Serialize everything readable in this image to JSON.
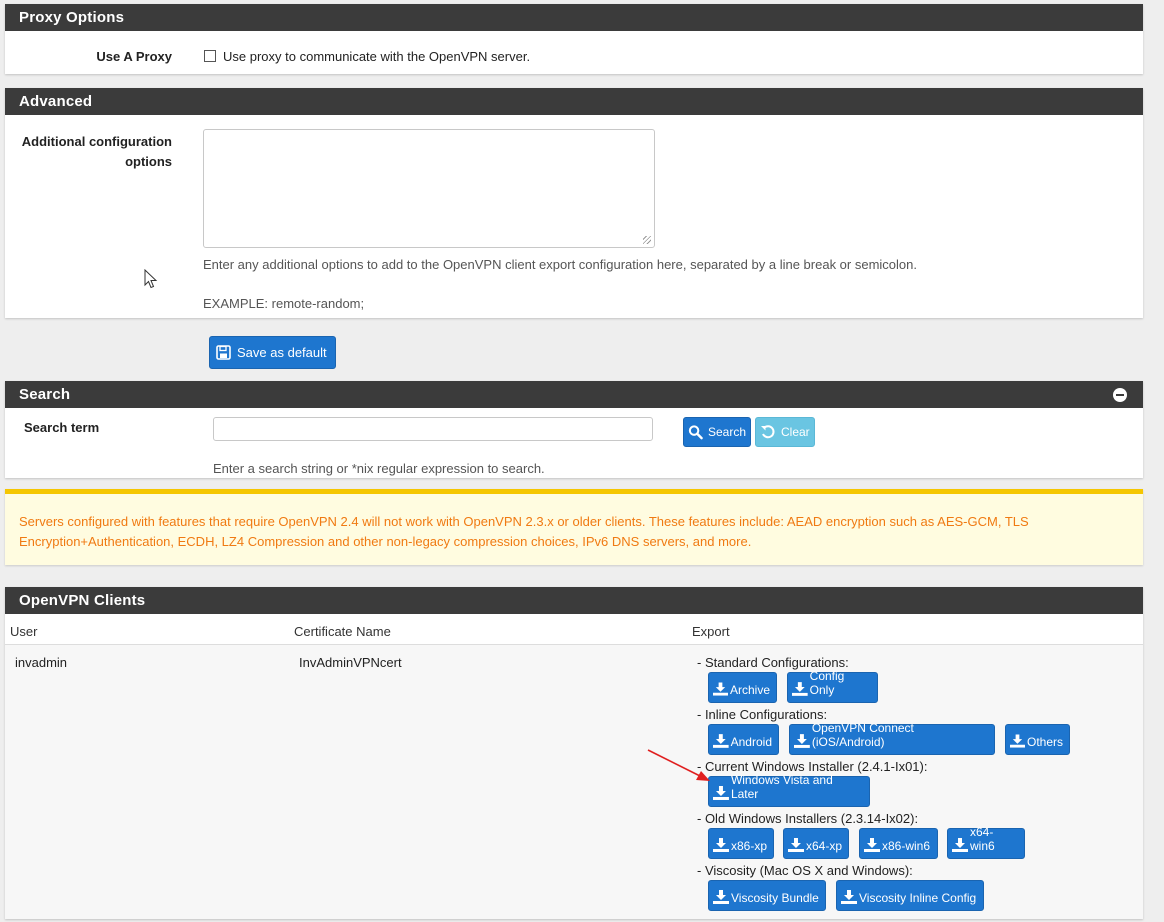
{
  "proxy": {
    "heading": "Proxy Options",
    "use_proxy_label": "Use A Proxy",
    "use_proxy_text": "Use proxy to communicate with the OpenVPN server."
  },
  "advanced": {
    "heading": "Advanced",
    "config_label_line1": "Additional configuration",
    "config_label_line2": "options",
    "config_value": "",
    "help_text": "Enter any additional options to add to the OpenVPN client export configuration here, separated by a line break or semicolon.",
    "example_text": "EXAMPLE: remote-random;"
  },
  "save_button": "Save as default",
  "search": {
    "heading": "Search",
    "term_label": "Search term",
    "input_value": "",
    "search_button": "Search",
    "clear_button": "Clear",
    "help_text": "Enter a search string or *nix regular expression to search."
  },
  "warning": {
    "text": "Servers configured with features that require OpenVPN 2.4 will not work with OpenVPN 2.3.x or older clients. These features include: AEAD encryption such as AES-GCM, TLS Encryption+Authentication, ECDH, LZ4 Compression and other non-legacy compression choices, IPv6 DNS servers, and more."
  },
  "clients": {
    "heading": "OpenVPN Clients",
    "columns": [
      "User",
      "Certificate Name",
      "Export"
    ],
    "row": {
      "user": "invadmin",
      "cert": "InvAdminVPNcert"
    },
    "groups": {
      "standard": "- Standard Configurations:",
      "inline": "- Inline Configurations:",
      "current_windows": "- Current Windows Installer (2.4.1-Ix01):",
      "old_windows": "- Old Windows Installers (2.3.14-Ix02):",
      "viscosity": "- Viscosity (Mac OS X and Windows):"
    },
    "buttons": {
      "archive": "Archive",
      "config_only": "Config Only",
      "android": "Android",
      "openvpn_connect": "OpenVPN Connect (iOS/Android)",
      "others": "Others",
      "windows_vista": "Windows Vista and Later",
      "x86_xp": "x86-xp",
      "x64_xp": "x64-xp",
      "x86_win6": "x86-win6",
      "x64_win6": "x64-win6",
      "viscosity_bundle": "Viscosity Bundle",
      "viscosity_inline": "Viscosity Inline Config"
    }
  },
  "colors": {
    "panel_heading": "#3b3b3b",
    "primary_button": "#1e76cf",
    "info_button": "#6ac5e2",
    "warning_text": "#f07a12",
    "warning_border": "#f5c600",
    "annotation_arrow": "#e02020"
  }
}
